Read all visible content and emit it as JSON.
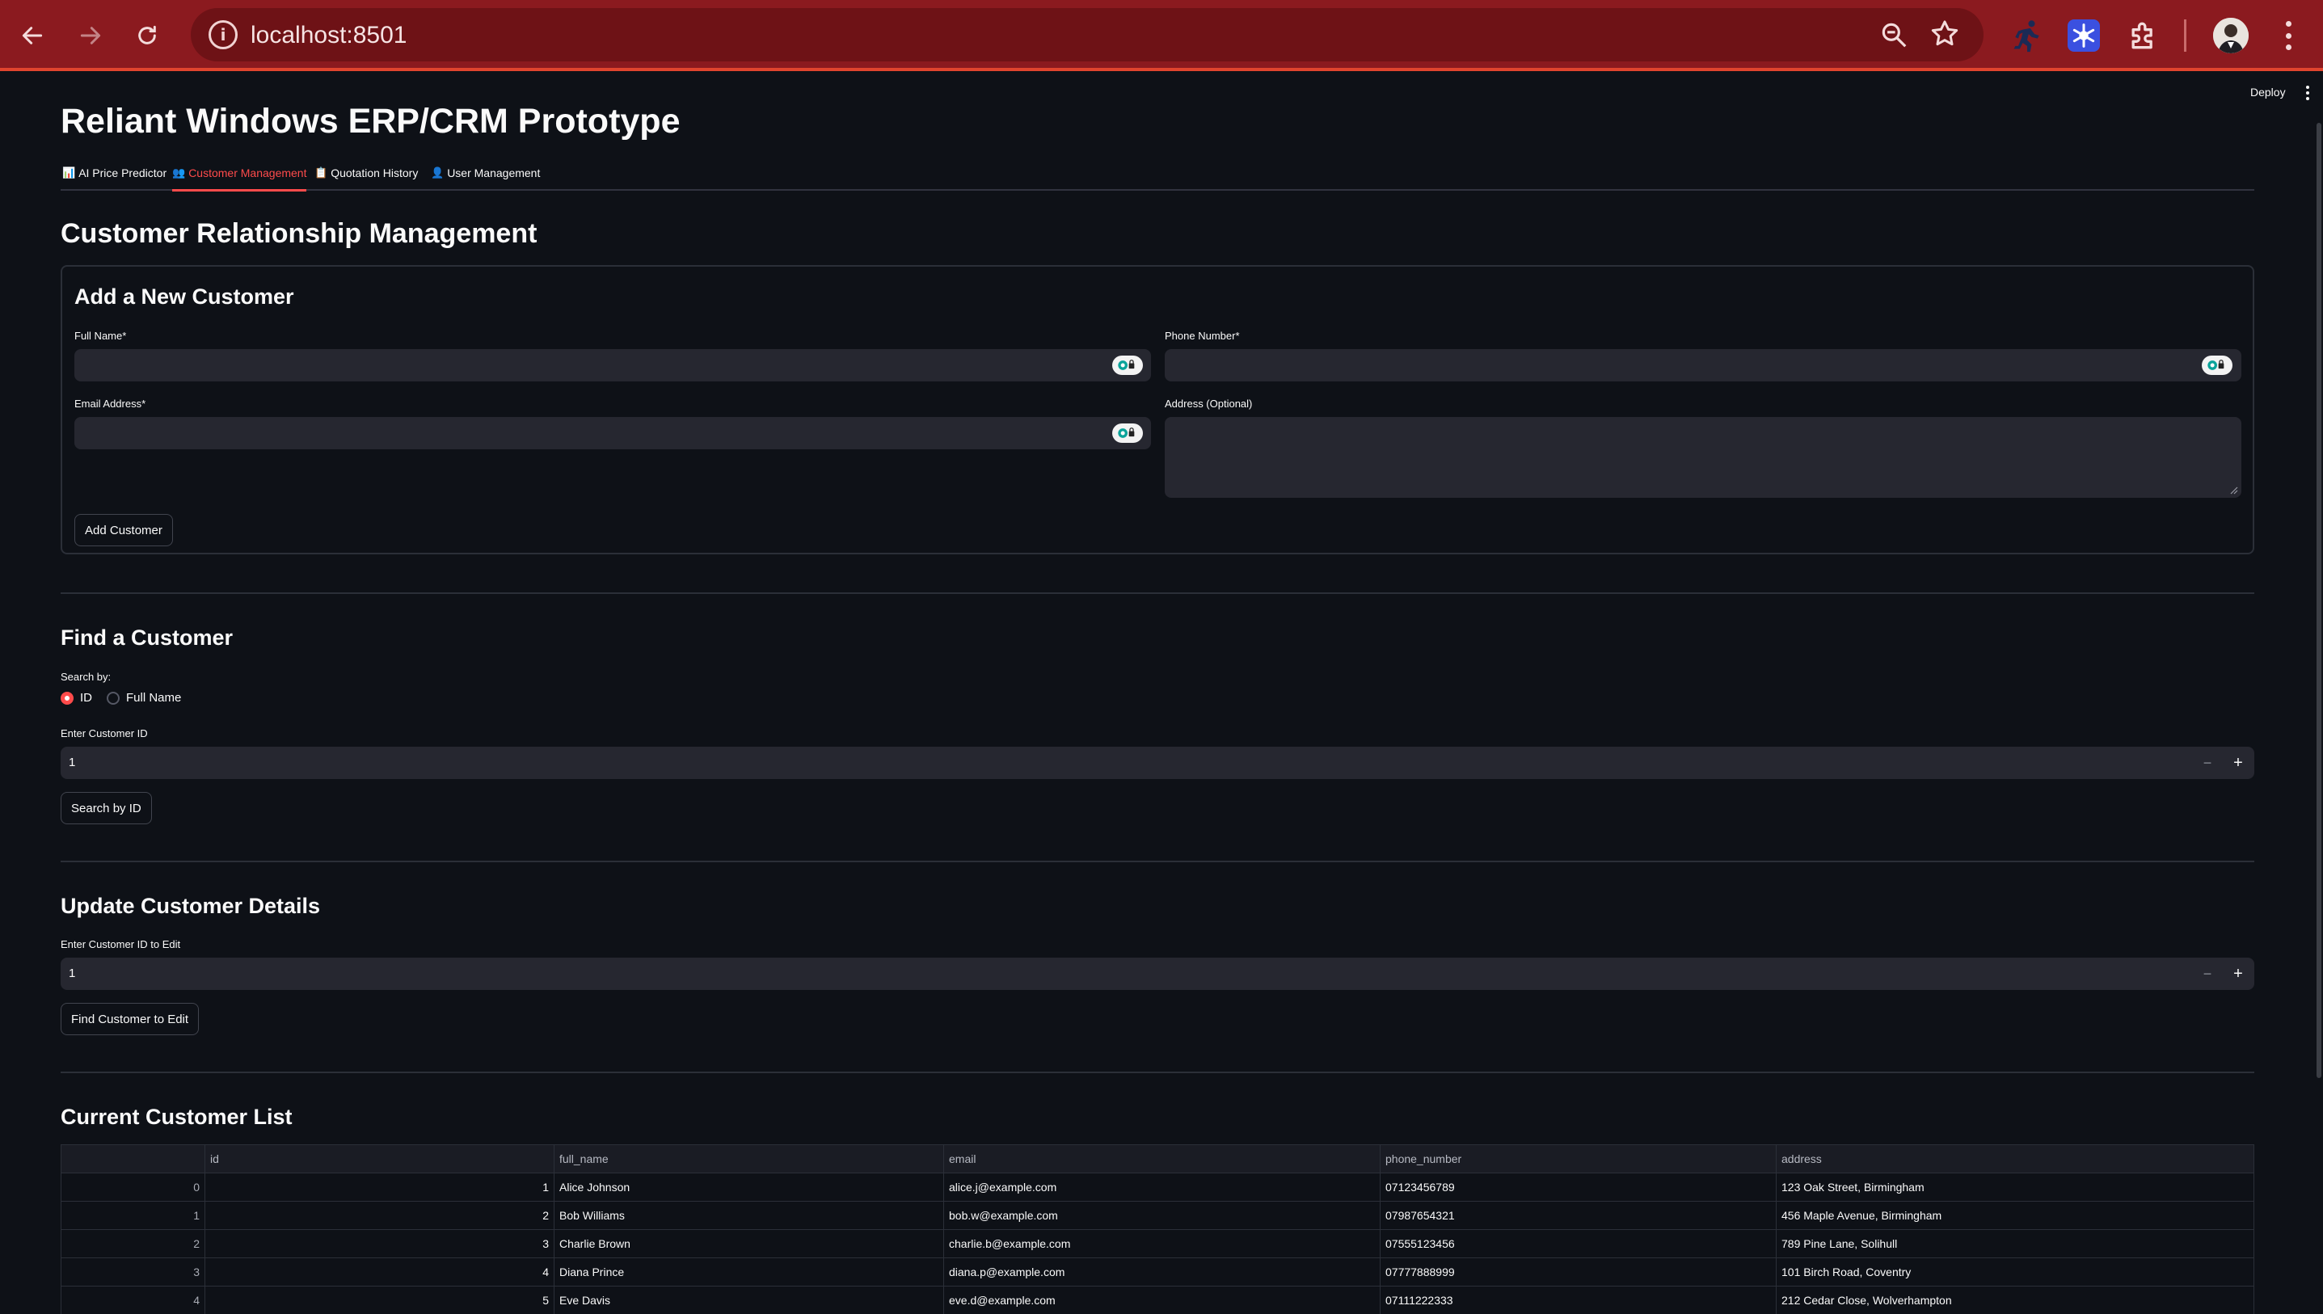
{
  "browser": {
    "url": "localhost:8501"
  },
  "app": {
    "deploy_label": "Deploy",
    "title": "Reliant Windows ERP/CRM Prototype",
    "tabs": [
      {
        "icon": "📊",
        "label": "AI Price Predictor",
        "active": false
      },
      {
        "icon": "👥",
        "label": "Customer Management",
        "active": true
      },
      {
        "icon": "📋",
        "label": "Quotation History",
        "active": false
      },
      {
        "icon": "👤",
        "label": "User Management",
        "active": false
      }
    ],
    "accent_color": "#ff4b4b"
  },
  "crm": {
    "title": "Customer Relationship Management",
    "add_form": {
      "title": "Add a New Customer",
      "full_name_label": "Full Name*",
      "full_name_value": "",
      "phone_label": "Phone Number*",
      "phone_value": "",
      "email_label": "Email Address*",
      "email_value": "",
      "address_label": "Address (Optional)",
      "address_value": "",
      "submit_label": "Add Customer"
    },
    "find": {
      "title": "Find a Customer",
      "search_by_label": "Search by:",
      "options": [
        "ID",
        "Full Name"
      ],
      "selected": "ID",
      "id_label": "Enter Customer ID",
      "id_value": "1",
      "button_label": "Search by ID"
    },
    "update": {
      "title": "Update Customer Details",
      "id_label": "Enter Customer ID to Edit",
      "id_value": "1",
      "button_label": "Find Customer to Edit"
    },
    "list": {
      "title": "Current Customer List",
      "columns": [
        "",
        "id",
        "full_name",
        "email",
        "phone_number",
        "address"
      ],
      "rows": [
        {
          "index": "0",
          "id": "1",
          "full_name": "Alice Johnson",
          "email": "alice.j@example.com",
          "phone_number": "07123456789",
          "address": "123 Oak Street, Birmingham"
        },
        {
          "index": "1",
          "id": "2",
          "full_name": "Bob Williams",
          "email": "bob.w@example.com",
          "phone_number": "07987654321",
          "address": "456 Maple Avenue, Birmingham"
        },
        {
          "index": "2",
          "id": "3",
          "full_name": "Charlie Brown",
          "email": "charlie.b@example.com",
          "phone_number": "07555123456",
          "address": "789 Pine Lane, Solihull"
        },
        {
          "index": "3",
          "id": "4",
          "full_name": "Diana Prince",
          "email": "diana.p@example.com",
          "phone_number": "07777888999",
          "address": "101 Birch Road, Coventry"
        },
        {
          "index": "4",
          "id": "5",
          "full_name": "Eve Davis",
          "email": "eve.d@example.com",
          "phone_number": "07111222333",
          "address": "212 Cedar Close, Wolverhampton"
        }
      ]
    }
  }
}
